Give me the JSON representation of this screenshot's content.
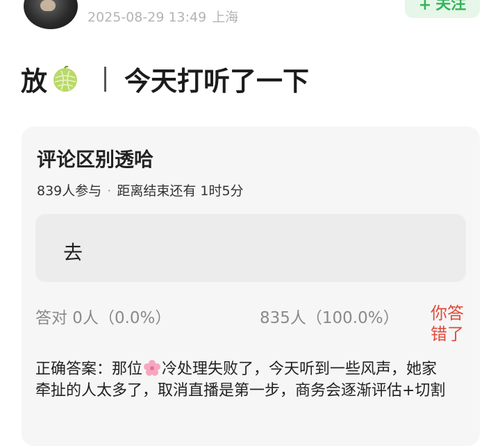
{
  "post": {
    "timestamp": "2025-08-29 13:49",
    "location": "上海",
    "follow_label": "关注",
    "follow_plus": "+",
    "title_left": "放",
    "title_right": "今天打听了一下"
  },
  "poll": {
    "title": "评论区别透哈",
    "participants": "839人参与",
    "dot": "·",
    "remaining": "距离结束还有 1时5分",
    "option": "去",
    "correct_stat": "答对  0人（0.0%）",
    "option_stat": "835人（100.0%）",
    "result_line1": "你答",
    "result_line2": "错了",
    "answer_prefix": "正确答案：那位",
    "answer_rest": "冷处理失败了，今天听到一些风声，她家牵扯的人太多了，取消直播是第一步，商务会逐渐评估+切割"
  },
  "colors": {
    "accent_green": "#35b35a",
    "error_red": "#e04a3a"
  },
  "icons": {
    "title_emoji": "melon-icon",
    "answer_emoji": "cherry-blossom-icon"
  }
}
